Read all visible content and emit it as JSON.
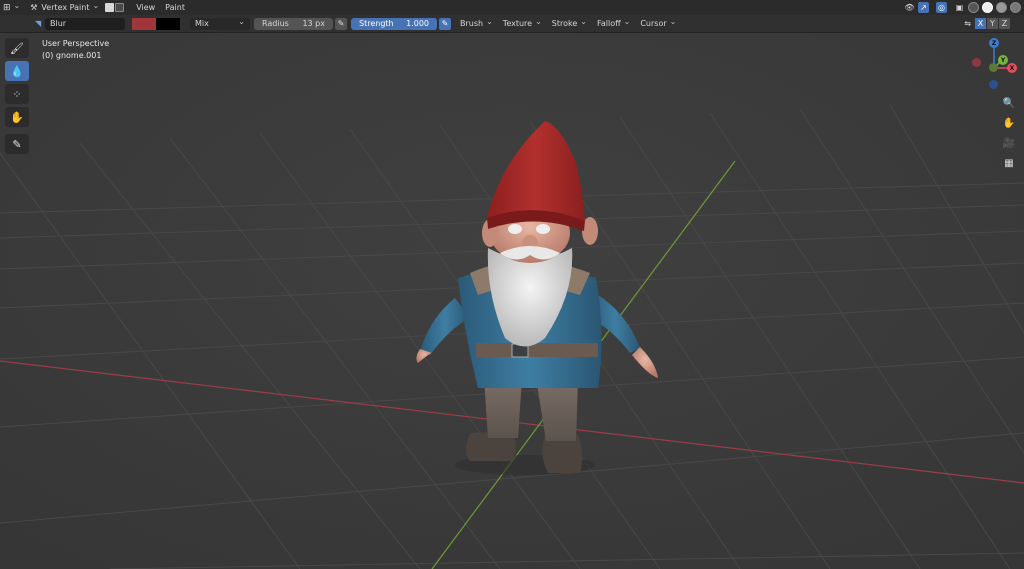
{
  "header": {
    "mode_label": "Vertex Paint",
    "menus": [
      "View",
      "Paint"
    ]
  },
  "tool_settings": {
    "brush_name": "Blur",
    "color_primary": "#a0363a",
    "color_secondary": "#000000",
    "blend_mode": "Mix",
    "radius_label": "Radius",
    "radius_value": "13 px",
    "strength_label": "Strength",
    "strength_value": "1.000",
    "menus": [
      "Brush",
      "Texture",
      "Stroke",
      "Falloff",
      "Cursor"
    ]
  },
  "viewport": {
    "view_name": "User Perspective",
    "object_name": "(0) gnome.001"
  },
  "axis": {
    "x_label": "X",
    "y_label": "Y",
    "z_label": "Z",
    "x_color": "#e24f5c",
    "y_color": "#7ab33f",
    "z_color": "#3c7bd5"
  },
  "icons": {
    "toolbar": [
      "draw-brush-icon",
      "blur-drop-icon",
      "average-icon",
      "smear-icon",
      "annotate-icon"
    ],
    "nav": [
      "zoom-icon",
      "hand-pan-icon",
      "camera-icon",
      "grid-icon"
    ]
  },
  "colors": {
    "accent": "#4772b3",
    "background": "#3a3a3a",
    "header": "#2b2b2b"
  }
}
